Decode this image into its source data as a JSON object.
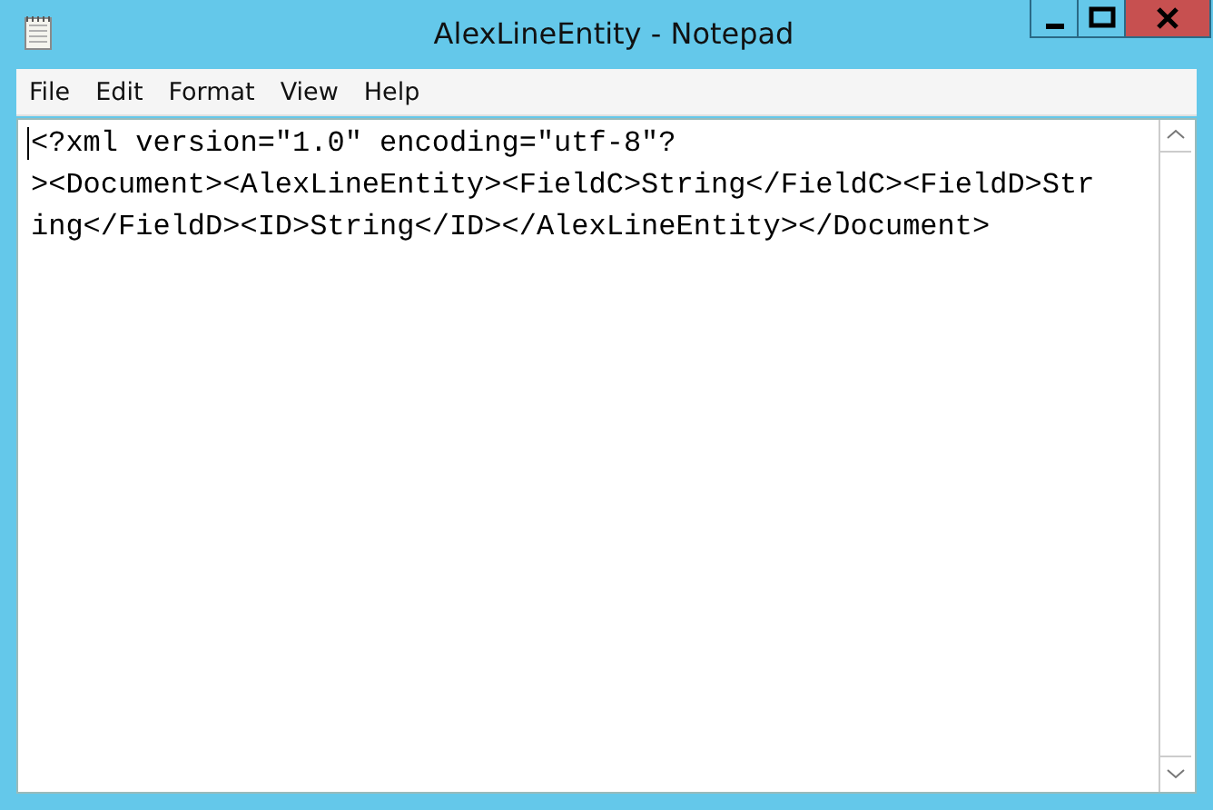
{
  "window": {
    "title": "AlexLineEntity - Notepad"
  },
  "menu": [
    "File",
    "Edit",
    "Format",
    "View",
    "Help"
  ],
  "editor": {
    "lines": [
      "<?xml version=\"1.0\" encoding=\"utf-8\"?",
      "><Document><AlexLineEntity><FieldC>String</FieldC><FieldD>Str",
      "ing</FieldD><ID>String</ID></AlexLineEntity></Document>"
    ]
  }
}
